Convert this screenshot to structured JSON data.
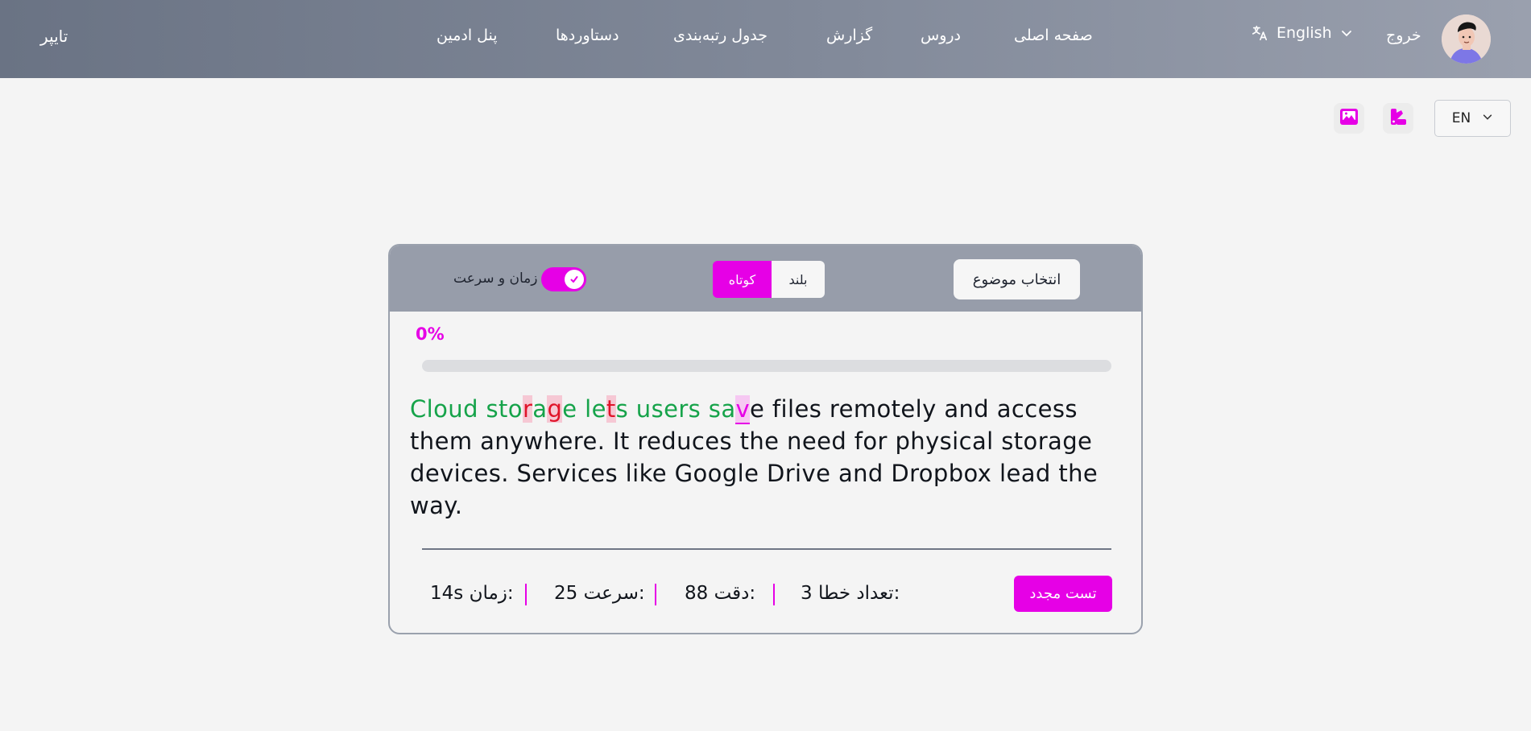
{
  "navbar": {
    "brand": "تایپر",
    "links": [
      {
        "id": "home",
        "label": "صفحه اصلی"
      },
      {
        "id": "lessons",
        "label": "دروس"
      },
      {
        "id": "report",
        "label": "گزارش"
      },
      {
        "id": "leaderboard",
        "label": "جدول رتبه‌بندی"
      },
      {
        "id": "achievements",
        "label": "دستاوردها"
      },
      {
        "id": "admin",
        "label": "پنل ادمین"
      }
    ],
    "language_label": "English",
    "logout_label": "خروج"
  },
  "toolbar": {
    "language_select_value": "EN",
    "icons": [
      "image-icon",
      "palette-icon"
    ]
  },
  "card": {
    "topic_button": "انتخاب موضوع",
    "length_options": {
      "long": "بلند",
      "short": "کوتاه",
      "selected": "short"
    },
    "toggle_label": "زمان و سرعت",
    "toggle_on": true,
    "progress_text": "0%",
    "progress_value": 0,
    "passage_text": "Cloud storage lets users save files remotely and access them anywhere. It reduces the need for physical storage devices. Services like Google Drive and Dropbox lead the way.",
    "typed_char_count": 27,
    "error_positions": [
      9,
      11,
      16
    ],
    "stats": {
      "errors_label": "تعداد خطا:",
      "errors_value": "3",
      "accuracy_label": "دقت:",
      "accuracy_value": "88",
      "speed_label": "سرعت:",
      "speed_value": "25",
      "time_label": "زمان:",
      "time_value": "14s"
    },
    "retry_button": "تست مجدد"
  },
  "colors": {
    "accent": "#e600e6",
    "correct": "#16a34a",
    "error": "#e0142a"
  }
}
